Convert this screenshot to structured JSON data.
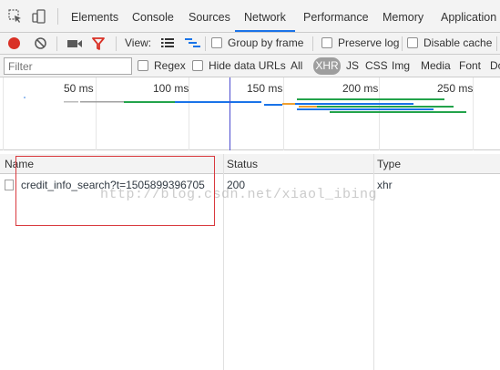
{
  "main_tabs": [
    {
      "label": "Elements"
    },
    {
      "label": "Console"
    },
    {
      "label": "Sources"
    },
    {
      "label": "Network",
      "active": true
    },
    {
      "label": "Performance"
    },
    {
      "label": "Memory"
    },
    {
      "label": "Application"
    }
  ],
  "toolbar": {
    "view_label": "View:",
    "group_by_frame": "Group by frame",
    "preserve_log": "Preserve log",
    "disable_cache": "Disable cache",
    "record_color": "#d93025",
    "filter_icon_color": "#d93025"
  },
  "filterbar": {
    "placeholder": "Filter",
    "regex": "Regex",
    "hide_data_urls": "Hide data URLs",
    "types": [
      "All",
      "XHR",
      "JS",
      "CSS",
      "Img",
      "Media",
      "Font",
      "Do"
    ],
    "selected_type": "XHR"
  },
  "overview": {
    "ticks": [
      "50 ms",
      "100 ms",
      "150 ms",
      "200 ms",
      "250 ms"
    ]
  },
  "table": {
    "headers": {
      "name": "Name",
      "status": "Status",
      "type": "Type"
    },
    "rows": [
      {
        "name": "credit_info_search?t=1505899396705",
        "status": "200",
        "type": "xhr"
      }
    ]
  },
  "watermark": "http://blog.csdn.net/xiaol_ibing"
}
